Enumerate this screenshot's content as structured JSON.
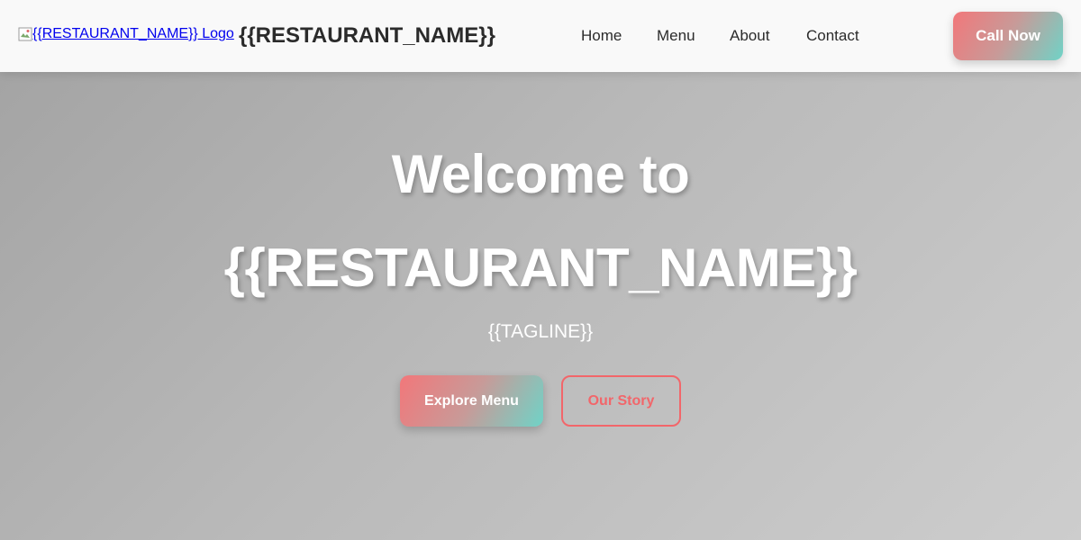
{
  "header": {
    "logo_alt": "{{RESTAURANT_NAME}} Logo",
    "brand_name": "{{RESTAURANT_NAME}}",
    "nav": {
      "home": "Home",
      "menu": "Menu",
      "about": "About",
      "contact": "Contact"
    },
    "cta_label": "Call Now"
  },
  "hero": {
    "title_line1": "Welcome to",
    "title_line2": "{{RESTAURANT_NAME}}",
    "tagline": "{{TAGLINE}}",
    "primary_button": "Explore Menu",
    "secondary_button": "Our Story"
  },
  "colors": {
    "accent_red": "#f2666a",
    "accent_teal": "#6fd3c7",
    "header_bg": "#f9f9f9",
    "hero_bg": "#b5b5b5"
  },
  "icons": {
    "logo": "broken-image-icon"
  }
}
